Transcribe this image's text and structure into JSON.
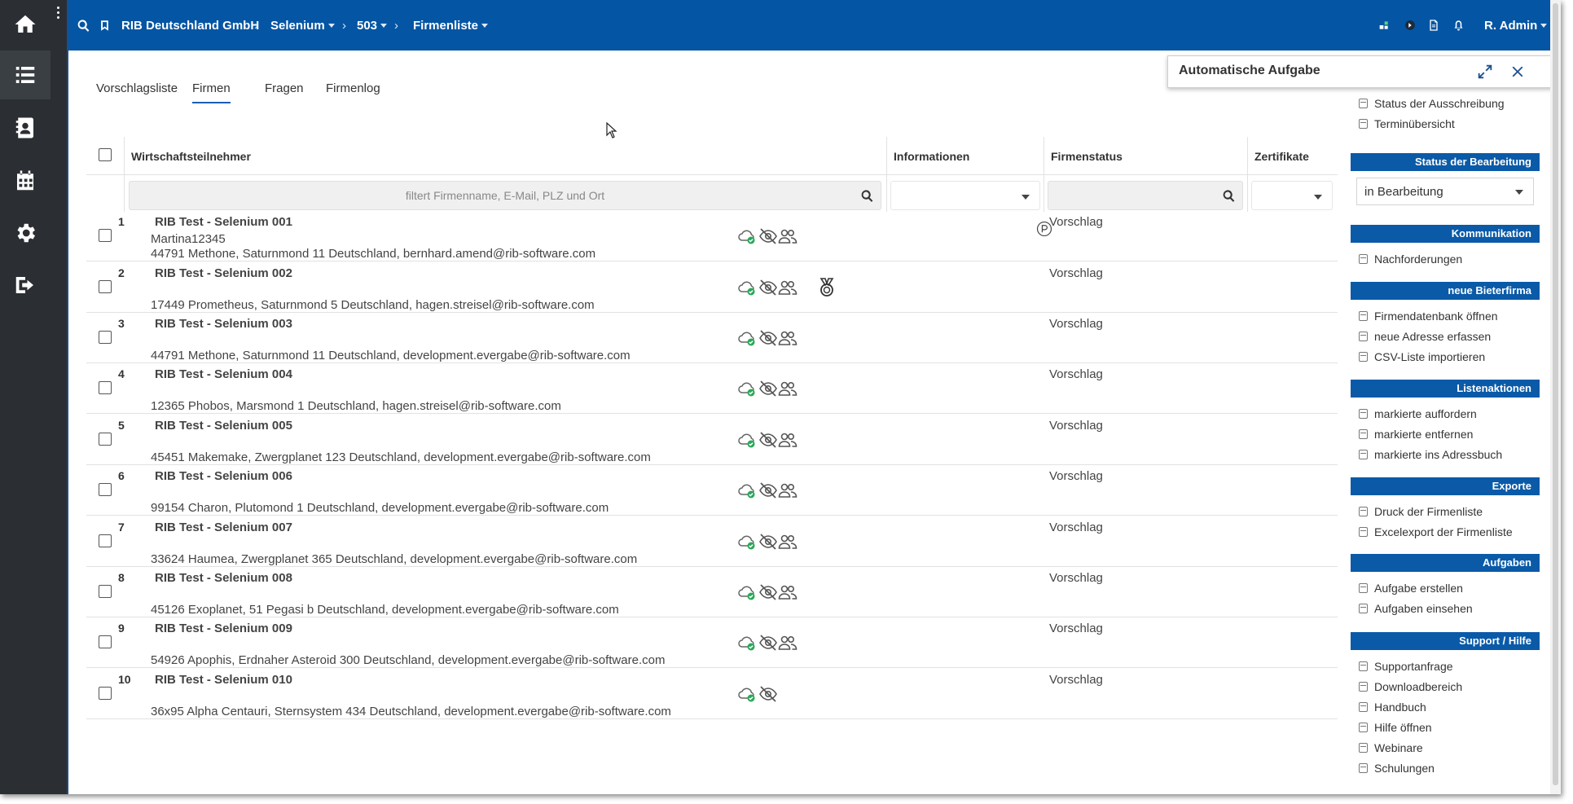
{
  "rail": {
    "items": [
      {
        "name": "home"
      },
      {
        "name": "list",
        "active": true
      },
      {
        "name": "contacts"
      },
      {
        "name": "calendar"
      },
      {
        "name": "settings"
      },
      {
        "name": "logout"
      }
    ]
  },
  "topbar": {
    "company": "RIB Deutschland GmbH",
    "project": "Selenium",
    "number": "503",
    "page": "Firmenliste",
    "user": "R. Admin"
  },
  "tabs": [
    "Vorschlagsliste",
    "Firmen",
    "Fragen",
    "Firmenlog"
  ],
  "active_tab": 1,
  "table": {
    "headers": {
      "participant": "Wirtschaftsteilnehmer",
      "info": "Informationen",
      "status": "Firmenstatus",
      "certs": "Zertifikate"
    },
    "filter_placeholder": "filtert Firmenname, E-Mail, PLZ und Ort",
    "rows": [
      {
        "num": "1",
        "name": "RIB Test - Selenium 001",
        "contact": "Martina12345",
        "address": "44791 Methone, Saturnmond 11 Deutschland, bernhard.amend@rib-software.com",
        "status": "Vorschlag",
        "icons": [
          "cloud-check-icon",
          "eye-off-icon",
          "users-icon"
        ],
        "cert": "p-circle-icon"
      },
      {
        "num": "2",
        "name": "RIB Test - Selenium 002",
        "contact": "",
        "address": "17449 Prometheus, Saturnmond 5 Deutschland, hagen.streisel@rib-software.com",
        "status": "Vorschlag",
        "icons": [
          "cloud-check-icon",
          "eye-off-icon",
          "users-icon",
          "medal-icon"
        ],
        "cert": ""
      },
      {
        "num": "3",
        "name": "RIB Test - Selenium 003",
        "contact": "",
        "address": "44791 Methone, Saturnmond 11 Deutschland, development.evergabe@rib-software.com",
        "status": "Vorschlag",
        "icons": [
          "cloud-check-icon",
          "eye-off-icon",
          "users-icon"
        ],
        "cert": ""
      },
      {
        "num": "4",
        "name": "RIB Test - Selenium 004",
        "contact": "",
        "address": "12365 Phobos, Marsmond 1 Deutschland, hagen.streisel@rib-software.com",
        "status": "Vorschlag",
        "icons": [
          "cloud-check-icon",
          "eye-off-icon",
          "users-icon"
        ],
        "cert": ""
      },
      {
        "num": "5",
        "name": "RIB Test - Selenium 005",
        "contact": "",
        "address": "45451 Makemake, Zwergplanet 123 Deutschland, development.evergabe@rib-software.com",
        "status": "Vorschlag",
        "icons": [
          "cloud-check-icon",
          "eye-off-icon",
          "users-icon"
        ],
        "cert": ""
      },
      {
        "num": "6",
        "name": "RIB Test - Selenium 006",
        "contact": "",
        "address": "99154 Charon, Plutomond 1 Deutschland, development.evergabe@rib-software.com",
        "status": "Vorschlag",
        "icons": [
          "cloud-check-icon",
          "eye-off-icon",
          "users-icon"
        ],
        "cert": ""
      },
      {
        "num": "7",
        "name": "RIB Test - Selenium 007",
        "contact": "",
        "address": "33624 Haumea, Zwergplanet 365 Deutschland, development.evergabe@rib-software.com",
        "status": "Vorschlag",
        "icons": [
          "cloud-check-icon",
          "eye-off-icon",
          "users-icon"
        ],
        "cert": ""
      },
      {
        "num": "8",
        "name": "RIB Test - Selenium 008",
        "contact": "",
        "address": "45126 Exoplanet, 51 Pegasi b Deutschland, development.evergabe@rib-software.com",
        "status": "Vorschlag",
        "icons": [
          "cloud-check-icon",
          "eye-off-icon",
          "users-icon"
        ],
        "cert": ""
      },
      {
        "num": "9",
        "name": "RIB Test - Selenium 009",
        "contact": "",
        "address": "54926 Apophis, Erdnaher Asteroid 300 Deutschland, development.evergabe@rib-software.com",
        "status": "Vorschlag",
        "icons": [
          "cloud-check-icon",
          "eye-off-icon",
          "users-icon"
        ],
        "cert": ""
      },
      {
        "num": "10",
        "name": "RIB Test - Selenium 010",
        "contact": "",
        "address": "36x95 Alpha Centauri, Sternsystem 434 Deutschland, development.evergabe@rib-software.com",
        "status": "Vorschlag",
        "icons": [
          "cloud-check-icon",
          "eye-off-icon"
        ],
        "cert": ""
      }
    ]
  },
  "popup": {
    "title": "Automatische Aufgabe"
  },
  "panel": {
    "top_links": [
      "Status der Ausschreibung",
      "Terminübersicht"
    ],
    "sections": [
      {
        "title": "Status der Bearbeitung",
        "select": "in Bearbeitung",
        "links": []
      },
      {
        "title": "Kommunikation",
        "links": [
          "Nachforderungen"
        ]
      },
      {
        "title": "neue Bieterfirma",
        "links": [
          "Firmendatenbank öffnen",
          "neue Adresse erfassen",
          "CSV-Liste importieren"
        ]
      },
      {
        "title": "Listenaktionen",
        "links": [
          "markierte auffordern",
          "markierte entfernen",
          "markierte ins Adressbuch"
        ]
      },
      {
        "title": "Exporte",
        "links": [
          "Druck der Firmenliste",
          "Excelexport der Firmenliste"
        ]
      },
      {
        "title": "Aufgaben",
        "links": [
          "Aufgabe erstellen",
          "Aufgaben einsehen"
        ]
      },
      {
        "title": "Support / Hilfe",
        "links": [
          "Supportanfrage",
          "Downloadbereich",
          "Handbuch",
          "Hilfe öffnen",
          "Webinare",
          "Schulungen"
        ]
      }
    ]
  },
  "colors": {
    "topbar": "#0455a4",
    "rail": "#2b2f33",
    "panel_head": "#0a5aa8",
    "accent": "#1a5fb4"
  }
}
